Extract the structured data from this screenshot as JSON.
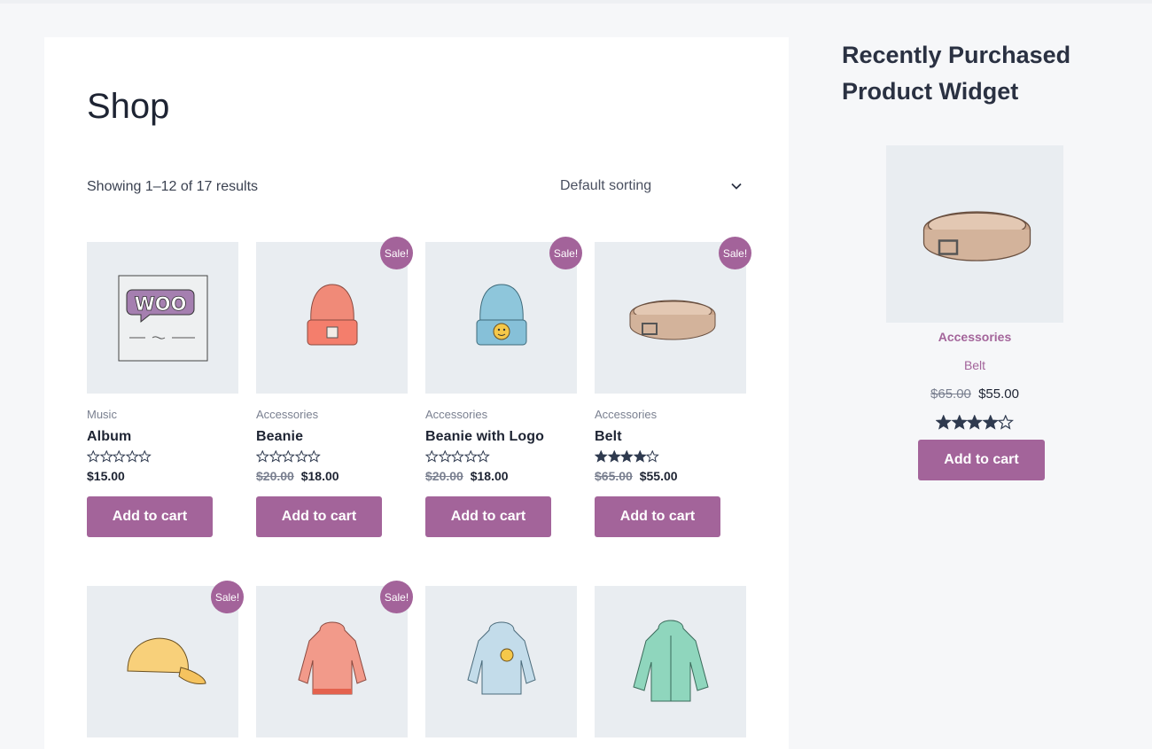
{
  "colors": {
    "accent": "#a3649a",
    "thumb_bg": "#e9edf1",
    "text": "#1e2433"
  },
  "shop": {
    "title": "Shop",
    "result_count": "Showing 1–12 of 17 results",
    "sorting": {
      "selected": "Default sorting",
      "icon": "chevron-down-icon"
    },
    "sale_label": "Sale!",
    "products": [
      {
        "category": "Music",
        "name": "Album",
        "rating": 0,
        "old_price": "",
        "price": "$15.00",
        "sale": false,
        "button": "Add to cart",
        "image": "album"
      },
      {
        "category": "Accessories",
        "name": "Beanie",
        "rating": 0,
        "old_price": "$20.00",
        "price": "$18.00",
        "sale": true,
        "button": "Add to cart",
        "image": "beanie"
      },
      {
        "category": "Accessories",
        "name": "Beanie with Logo",
        "rating": 0,
        "old_price": "$20.00",
        "price": "$18.00",
        "sale": true,
        "button": "Add to cart",
        "image": "beanie-logo"
      },
      {
        "category": "Accessories",
        "name": "Belt",
        "rating": 4,
        "old_price": "$65.00",
        "price": "$55.00",
        "sale": true,
        "button": "Add to cart",
        "image": "belt"
      },
      {
        "sale": true,
        "image": "cap"
      },
      {
        "sale": true,
        "image": "hoodie"
      },
      {
        "sale": false,
        "image": "hoodie-logo"
      },
      {
        "sale": false,
        "image": "hoodie-zipper"
      }
    ]
  },
  "sidebar": {
    "widget_title": "Recently Purchased Product Widget",
    "product": {
      "category": "Accessories",
      "name": "Belt",
      "old_price": "$65.00",
      "price": "$55.00",
      "rating": 4,
      "button": "Add to cart",
      "image": "belt"
    }
  }
}
